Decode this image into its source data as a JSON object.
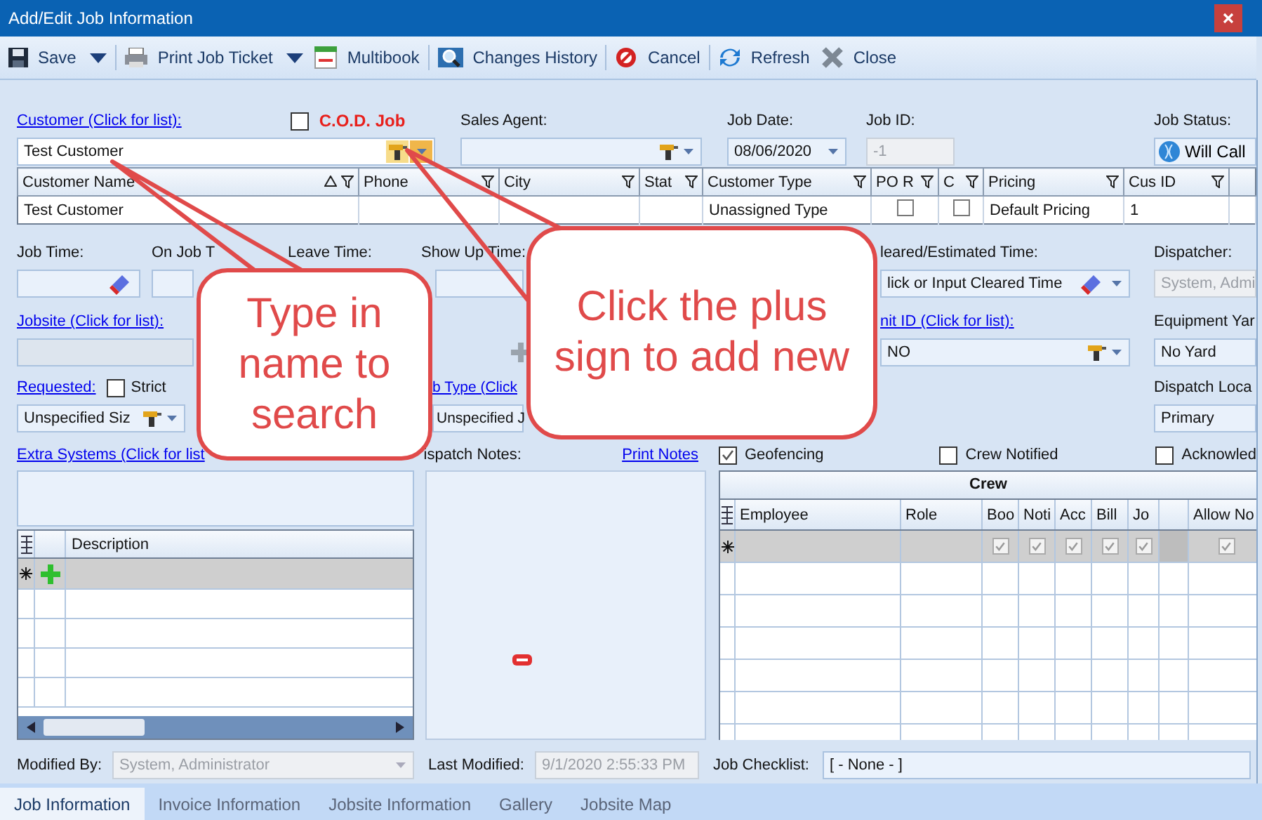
{
  "window": {
    "title": "Add/Edit Job Information"
  },
  "toolbar": [
    {
      "label": "Save",
      "kind": "save",
      "dropdown": true
    },
    {
      "label": "Print Job Ticket",
      "kind": "print",
      "dropdown": true
    },
    {
      "label": "Multibook",
      "kind": "multibook",
      "dropdown": false
    },
    {
      "label": "Changes History",
      "kind": "history",
      "dropdown": false
    },
    {
      "label": "Cancel",
      "kind": "cancel",
      "dropdown": false
    },
    {
      "label": "Refresh",
      "kind": "refresh",
      "dropdown": false
    },
    {
      "label": "Close",
      "kind": "close",
      "dropdown": false
    }
  ],
  "customer": {
    "label": "Customer (Click for list):",
    "value": "Test Customer",
    "cod": {
      "label": "C.O.D. Job",
      "checked": false
    }
  },
  "sales_agent": {
    "label": "Sales Agent:"
  },
  "job_date": {
    "label": "Job Date:",
    "value": "08/06/2020"
  },
  "job_id": {
    "label": "Job ID:",
    "value": "-1"
  },
  "job_status": {
    "label": "Job Status:",
    "value": "Will Call"
  },
  "customer_list": {
    "columns": [
      {
        "label": "Customer Name",
        "sorted": true
      },
      {
        "label": "Phone",
        "sorted": false
      },
      {
        "label": "City",
        "sorted": false
      },
      {
        "label": "Stat",
        "sorted": false
      },
      {
        "label": "Customer Type",
        "sorted": false
      },
      {
        "label": "PO R",
        "sorted": false
      },
      {
        "label": "C",
        "sorted": false
      },
      {
        "label": "Pricing",
        "sorted": false
      },
      {
        "label": "Cus ID",
        "sorted": false
      }
    ],
    "rows": [
      {
        "name": "Test Customer",
        "customer_type": "Unassigned Type",
        "po_required": false,
        "c": false,
        "pricing": "Default Pricing",
        "cus_id": "1"
      }
    ]
  },
  "times": [
    {
      "label": "Job Time:"
    },
    {
      "label": "On Job T"
    },
    {
      "label": "Leave Time:"
    },
    {
      "label": "Show Up Time:"
    }
  ],
  "cleared_time": {
    "label": "leared/Estimated Time:",
    "placeholder": "lick or Input Cleared Time"
  },
  "dispatcher": {
    "label": "Dispatcher:",
    "value": "System, Admi"
  },
  "jobsite": {
    "label": "Jobsite (Click for list):"
  },
  "unit_id": {
    "label": "nit ID (Click for list):",
    "value": "NO"
  },
  "equipment_yard": {
    "label": "Equipment Yar",
    "value": "No Yard"
  },
  "requested": {
    "label": "Requested:",
    "strict": {
      "label": "Strict",
      "checked": false
    },
    "value": "Unspecified Siz"
  },
  "job_type": {
    "label": "b Type (Click",
    "value": "Unspecified J"
  },
  "dispatch_location": {
    "label": "Dispatch Loca",
    "value": "Primary"
  },
  "extra_systems": {
    "label": "Extra Systems (Click for list"
  },
  "description_grid": {
    "columns": [
      "Description"
    ]
  },
  "dispatch_notes": {
    "label": "ispatch Notes:",
    "link": "Print Notes"
  },
  "flags": [
    {
      "label": "Geofencing",
      "checked": true
    },
    {
      "label": "Crew Notified",
      "checked": false
    },
    {
      "label": "Acknowled",
      "checked": false
    }
  ],
  "crew": {
    "title": "Crew",
    "columns": [
      {
        "label": "Employee",
        "kind": "text"
      },
      {
        "label": "Role",
        "kind": "text"
      },
      {
        "label": "Boo",
        "kind": "check",
        "default_checked": true
      },
      {
        "label": "Noti",
        "kind": "check",
        "default_checked": true
      },
      {
        "label": "Acc",
        "kind": "check",
        "default_checked": true
      },
      {
        "label": "Bill",
        "kind": "check",
        "default_checked": true
      },
      {
        "label": "Jo",
        "kind": "check",
        "default_checked": true
      },
      {
        "kind": "blank"
      },
      {
        "label": "Allow No",
        "kind": "check",
        "default_checked": true
      }
    ]
  },
  "modified_by": {
    "label": "Modified By:",
    "value": "System, Administrator"
  },
  "last_modified": {
    "label": "Last Modified:",
    "value": "9/1/2020 2:55:33 PM"
  },
  "job_checklist": {
    "label": "Job Checklist:",
    "value": "[ - None - ]"
  },
  "tabs": [
    {
      "label": "Job Information",
      "selected": true
    },
    {
      "label": "Invoice Information",
      "selected": false
    },
    {
      "label": "Jobsite Information",
      "selected": false
    },
    {
      "label": "Gallery",
      "selected": false
    },
    {
      "label": "Jobsite Map",
      "selected": false
    }
  ],
  "callouts": [
    {
      "text": "Type in name to search"
    },
    {
      "text": "Click the plus sign to add new"
    }
  ]
}
